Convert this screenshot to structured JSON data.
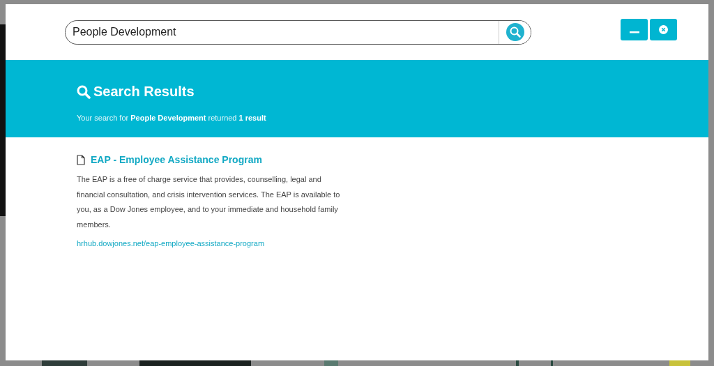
{
  "search": {
    "value": "People Development"
  },
  "window_buttons": [
    {
      "kind": "minimize"
    },
    {
      "kind": "close"
    }
  ],
  "results_header": {
    "title": "Search Results",
    "summary": "Your search for **People Development** returned **1 result**"
  },
  "results": [
    {
      "title": "EAP - Employee Assistance Program",
      "description": "The EAP is a free of charge service that provides, counselling, legal and financial consultation, and crisis intervention services. The EAP is available to you, as a Dow Jones employee, and to your immediate and household family members.",
      "url": "hrhub.dowjones.net/eap-employee-assistance-program"
    }
  ]
}
